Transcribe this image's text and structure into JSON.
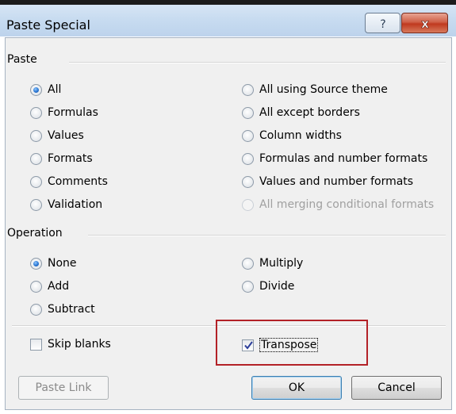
{
  "window": {
    "title": "Paste Special",
    "help_glyph": "?",
    "close_glyph": "x"
  },
  "paste_group": {
    "title": "Paste",
    "options_left": [
      {
        "label": "All",
        "checked": true,
        "enabled": true
      },
      {
        "label": "Formulas",
        "checked": false,
        "enabled": true
      },
      {
        "label": "Values",
        "checked": false,
        "enabled": true
      },
      {
        "label": "Formats",
        "checked": false,
        "enabled": true
      },
      {
        "label": "Comments",
        "checked": false,
        "enabled": true
      },
      {
        "label": "Validation",
        "checked": false,
        "enabled": true
      }
    ],
    "options_right": [
      {
        "label": "All using Source theme",
        "checked": false,
        "enabled": true
      },
      {
        "label": "All except borders",
        "checked": false,
        "enabled": true
      },
      {
        "label": "Column widths",
        "checked": false,
        "enabled": true
      },
      {
        "label": "Formulas and number formats",
        "checked": false,
        "enabled": true
      },
      {
        "label": "Values and number formats",
        "checked": false,
        "enabled": true
      },
      {
        "label": "All merging conditional formats",
        "checked": false,
        "enabled": false
      }
    ]
  },
  "operation_group": {
    "title": "Operation",
    "options_left": [
      {
        "label": "None",
        "checked": true
      },
      {
        "label": "Add",
        "checked": false
      },
      {
        "label": "Subtract",
        "checked": false
      }
    ],
    "options_right": [
      {
        "label": "Multiply",
        "checked": false
      },
      {
        "label": "Divide",
        "checked": false
      }
    ]
  },
  "checkboxes": {
    "skip_blanks": {
      "label": "Skip blanks",
      "checked": false
    },
    "transpose": {
      "label": "Transpose",
      "checked": true
    }
  },
  "buttons": {
    "paste_link": "Paste Link",
    "ok": "OK",
    "cancel": "Cancel"
  },
  "colors": {
    "highlight_box": "#b32127",
    "radio_selected": "#2a76d2"
  }
}
